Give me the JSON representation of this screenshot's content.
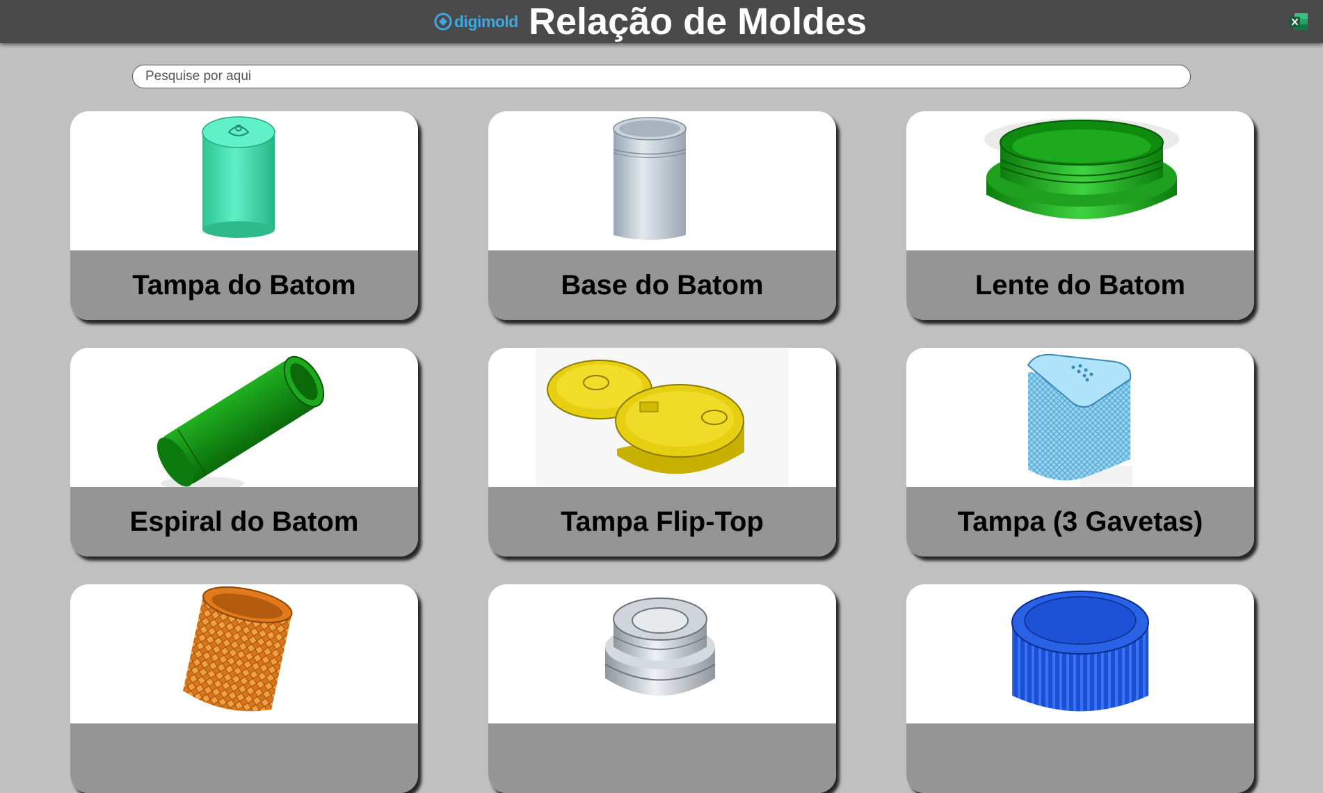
{
  "header": {
    "logo_text": "digimold",
    "title": "Relação de Moldes",
    "excel_icon": "excel-icon"
  },
  "search": {
    "placeholder": "Pesquise por aqui",
    "value": ""
  },
  "cards": [
    {
      "label": "Tampa do Batom",
      "color": "#3fe3b0"
    },
    {
      "label": "Base do Batom",
      "color": "#b8c3d0"
    },
    {
      "label": "Lente do Batom",
      "color": "#18a218"
    },
    {
      "label": "Espiral do Batom",
      "color": "#1a9a1a"
    },
    {
      "label": "Tampa Flip-Top",
      "color": "#e0c800"
    },
    {
      "label": "Tampa (3 Gavetas)",
      "color": "#8cd4f4"
    },
    {
      "label": "",
      "color": "#e07a1a"
    },
    {
      "label": "",
      "color": "#c9ced3"
    },
    {
      "label": "",
      "color": "#1a4fd8"
    }
  ],
  "colors": {
    "header_bg": "#4a4a4a",
    "page_bg": "#c0c0c0",
    "label_bg": "#959595"
  }
}
